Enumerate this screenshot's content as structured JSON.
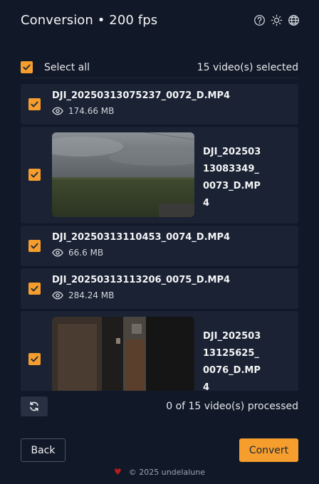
{
  "header": {
    "title": "Conversion • 200 fps",
    "icons": [
      "help-icon",
      "sun-icon",
      "globe-icon"
    ]
  },
  "selection": {
    "select_all_label": "Select all",
    "select_all_checked": true,
    "selected_count": "15 video(s) selected"
  },
  "videos": [
    {
      "name": "DJI_20250313075237_0072_D.MP4",
      "size": "174.66 MB",
      "checked": true,
      "has_thumbnail": false
    },
    {
      "name": "DJI_20250313083349_0073_D.MP4",
      "name_wrapped": [
        "DJI_202503",
        "13083349_",
        "0073_D.MP",
        "4"
      ],
      "checked": true,
      "has_thumbnail": true
    },
    {
      "name": "DJI_20250313110453_0074_D.MP4",
      "size": "66.6 MB",
      "checked": true,
      "has_thumbnail": false
    },
    {
      "name": "DJI_20250313113206_0075_D.MP4",
      "size": "284.24 MB",
      "checked": true,
      "has_thumbnail": false
    },
    {
      "name": "DJI_20250313125625_0076_D.MP4",
      "name_wrapped": [
        "DJI_202503",
        "13125625_",
        "0076_D.MP",
        "4"
      ],
      "checked": true,
      "has_thumbnail": true
    }
  ],
  "progress": {
    "processed_text": "0 of 15 video(s) processed",
    "refresh_icon": "refresh-icon"
  },
  "actions": {
    "back_label": "Back",
    "convert_label": "Convert"
  },
  "footer": {
    "copyright": "© 2025 undelalune"
  },
  "colors": {
    "background": "#111827",
    "card": "#1a2233",
    "accent": "#f59e2e"
  }
}
